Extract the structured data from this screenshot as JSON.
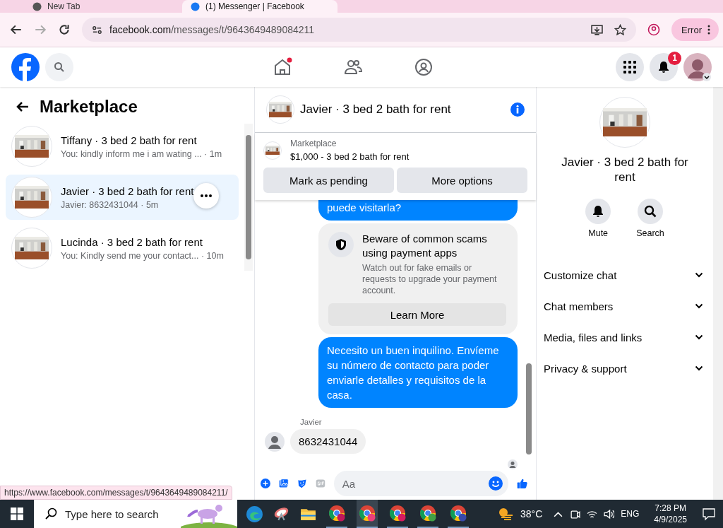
{
  "browser": {
    "tabs": [
      {
        "title": "New Tab",
        "selected": false
      },
      {
        "title": "(1) Messenger | Facebook",
        "selected": true
      }
    ],
    "url_domain": "facebook.com",
    "url_path": "/messages/t/9643649489084211",
    "profile_button": "Error"
  },
  "header": {
    "notification_count": "1"
  },
  "sidebar": {
    "title": "Marketplace",
    "conversations": [
      {
        "name": "Tiffany · 3 bed 2 bath for rent",
        "preview": "You: kindly inform me i am wating ... · 1m",
        "selected": false
      },
      {
        "name": "Javier · 3 bed 2 bath for rent",
        "preview": "Javier: 8632431044 · 5m",
        "selected": true
      },
      {
        "name": "Lucinda · 3 bed 2 bath for rent",
        "preview": "You: Kindly send me your contact... · 10m",
        "selected": false
      }
    ]
  },
  "chat": {
    "title": "Javier · 3 bed 2 bath for rent",
    "listing": {
      "label": "Marketplace",
      "title": "$1,000 - 3 bed 2 bath for rent"
    },
    "listing_buttons": [
      "Mark as pending",
      "More options"
    ],
    "messages": [
      {
        "kind": "outgoing",
        "text": "puede visitarla?",
        "cut": true
      },
      {
        "kind": "notice",
        "title": "Beware of common scams using payment apps",
        "text": "Watch out for fake emails or requests to upgrade your payment account.",
        "button": "Learn More"
      },
      {
        "kind": "outgoing",
        "text": "Necesito un buen inquilino. Envíeme su número de contacto para poder enviarle detalles y requisitos de la casa."
      },
      {
        "kind": "incoming",
        "sender": "Javier",
        "text": "8632431044"
      }
    ],
    "composer_placeholder": "Aa"
  },
  "info": {
    "title": "Javier · 3 bed 2 bath for rent",
    "actions": [
      {
        "kind": "bell",
        "label": "Mute"
      },
      {
        "kind": "search",
        "label": "Search"
      }
    ],
    "sections": [
      "Customize chat",
      "Chat members",
      "Media, files and links",
      "Privacy & support"
    ]
  },
  "status_url": "https://www.facebook.com/messages/t/9643649489084211/",
  "taskbar": {
    "search_placeholder": "Type here to search",
    "temperature": "38°C",
    "language": "ENG",
    "time": "7:28 PM",
    "date": "4/9/2025"
  }
}
